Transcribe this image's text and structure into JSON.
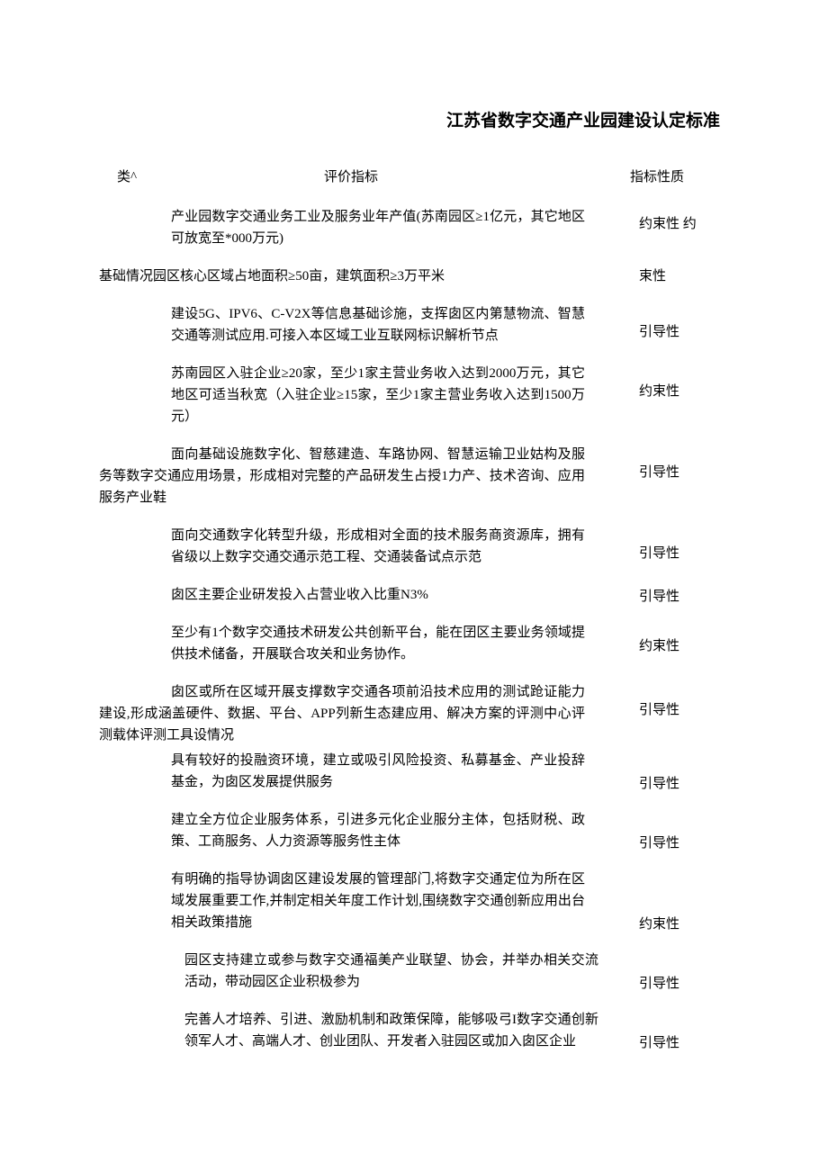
{
  "title": "江苏省数字交通产业园建设认定标准",
  "headers": {
    "category": "类^",
    "indicator": "评价指标",
    "nature": "指标性质"
  },
  "rows": [
    {
      "cat": "",
      "ind": "产业园数字交通业务工业及服务业年产值(苏南园区≥1亿元，其它地区可放宽至*000万元)",
      "nat": "约束性 约",
      "nat_pos": "nature-split1",
      "style": "indicator"
    },
    {
      "cat": "基础情况",
      "ind": "园区核心区域占地面积≥50亩，建筑面积≥3万平米",
      "nat": "束性",
      "nat_pos": "nature-split2",
      "style": "indicator-full",
      "cat_inline": true
    },
    {
      "cat": "",
      "ind": "建设5G、IPV6、C-V2X等信息基础诊施，支挥囱区内第慧物流、智慧交通等测试应用.可接入本区域工业互联网标识解析节点",
      "nat": "引导性",
      "nat_pos": "nature-mid",
      "style": "indicator"
    },
    {
      "cat": "",
      "ind": "苏南园区入驻企业≥20家，至少1家主营业务收入达到2000万元，其它地区可适当秋宽（入驻企业≥15家，至少1家主营业务收入达到1500万元）",
      "nat": "约束性",
      "nat_pos": "nature-mid",
      "style": "indicator"
    },
    {
      "cat": "",
      "ind": "面向基础设施数字化、智慈建造、车路协网、智慧运输卫业姑构及服务等数字交通应用场景，形成相对完整的产品研发生占授1力产、技术咨询、应用服务产业鞋",
      "nat": "引导性",
      "nat_pos": "nature-mid",
      "style": "indicator-full",
      "full_offset": true
    },
    {
      "cat": "",
      "ind": "面向交通数字化转型升级，形成相对全面的技术服务商资源库，拥有省级以上数字交通交通示范工程、交通装备试点示范",
      "nat": "引导性",
      "nat_pos": "nature-mid",
      "style": "indicator"
    },
    {
      "cat": "",
      "ind": "囱区主要企业研发投入占营业收入比重N3%",
      "nat": "引导性",
      "nat_pos": "nature-low",
      "style": "indicator"
    },
    {
      "cat": "",
      "ind": "至少有1个数字交通技术研发公共创新平台，能在囝区主要业务领域提供技术储备，开展联合攻关和业务协作。",
      "nat": "约束性",
      "nat_pos": "nature-top",
      "style": "indicator"
    },
    {
      "cat": "",
      "ind": "囱区或所在区域开展支撑数字交通各项前沿技术应用的测试跄证能力建设,形成涵盖硬件、数据、平台、APP列新生态建应用、解决方案的评测中心评测载体评测工具设情况",
      "nat": "引导性",
      "nat_pos": "nature-mid",
      "style": "indicator-full",
      "full_offset": true
    },
    {
      "cat": "",
      "ind": "具有较好的投融资环境，建立或吸引风险投资、私募基金、产业投辞基金，为囱区发展提供服务",
      "nat": "引导性",
      "nat_pos": "nature-low",
      "style": "indicator",
      "tight": true
    },
    {
      "cat": "",
      "ind": "建立全方位企业服务体系，引进多元化企业服分主体，包括财税、政策、工商服务、人力资源等服务性主体",
      "nat": "引导性",
      "nat_pos": "nature-low",
      "style": "indicator"
    },
    {
      "cat": "",
      "ind": "有明确的指导协调囱区建设发展的管理部门,将数字交通定位为所在区域发展重要工作,并制定相关年度工作计划,围绕数字交通创新应用出台相关政策措施",
      "nat": "约束性",
      "nat_pos": "nature-low",
      "style": "indicator"
    },
    {
      "cat": "",
      "ind": "园区支持建立或参与数字交通福美产业联望、协会，并举办相关交流活动，带动园区企业积极参为",
      "nat": "引导性",
      "nat_pos": "nature-low",
      "style": "indicator-offset"
    },
    {
      "cat": "",
      "ind": "完善人才培养、引进、激励机制和政策保障，能够吸弓I数字交通创新领军人才、高端人才、创业团队、开发者入驻园区或加入囱区企业",
      "nat": "引导性",
      "nat_pos": "nature-low",
      "style": "indicator-offset"
    }
  ]
}
